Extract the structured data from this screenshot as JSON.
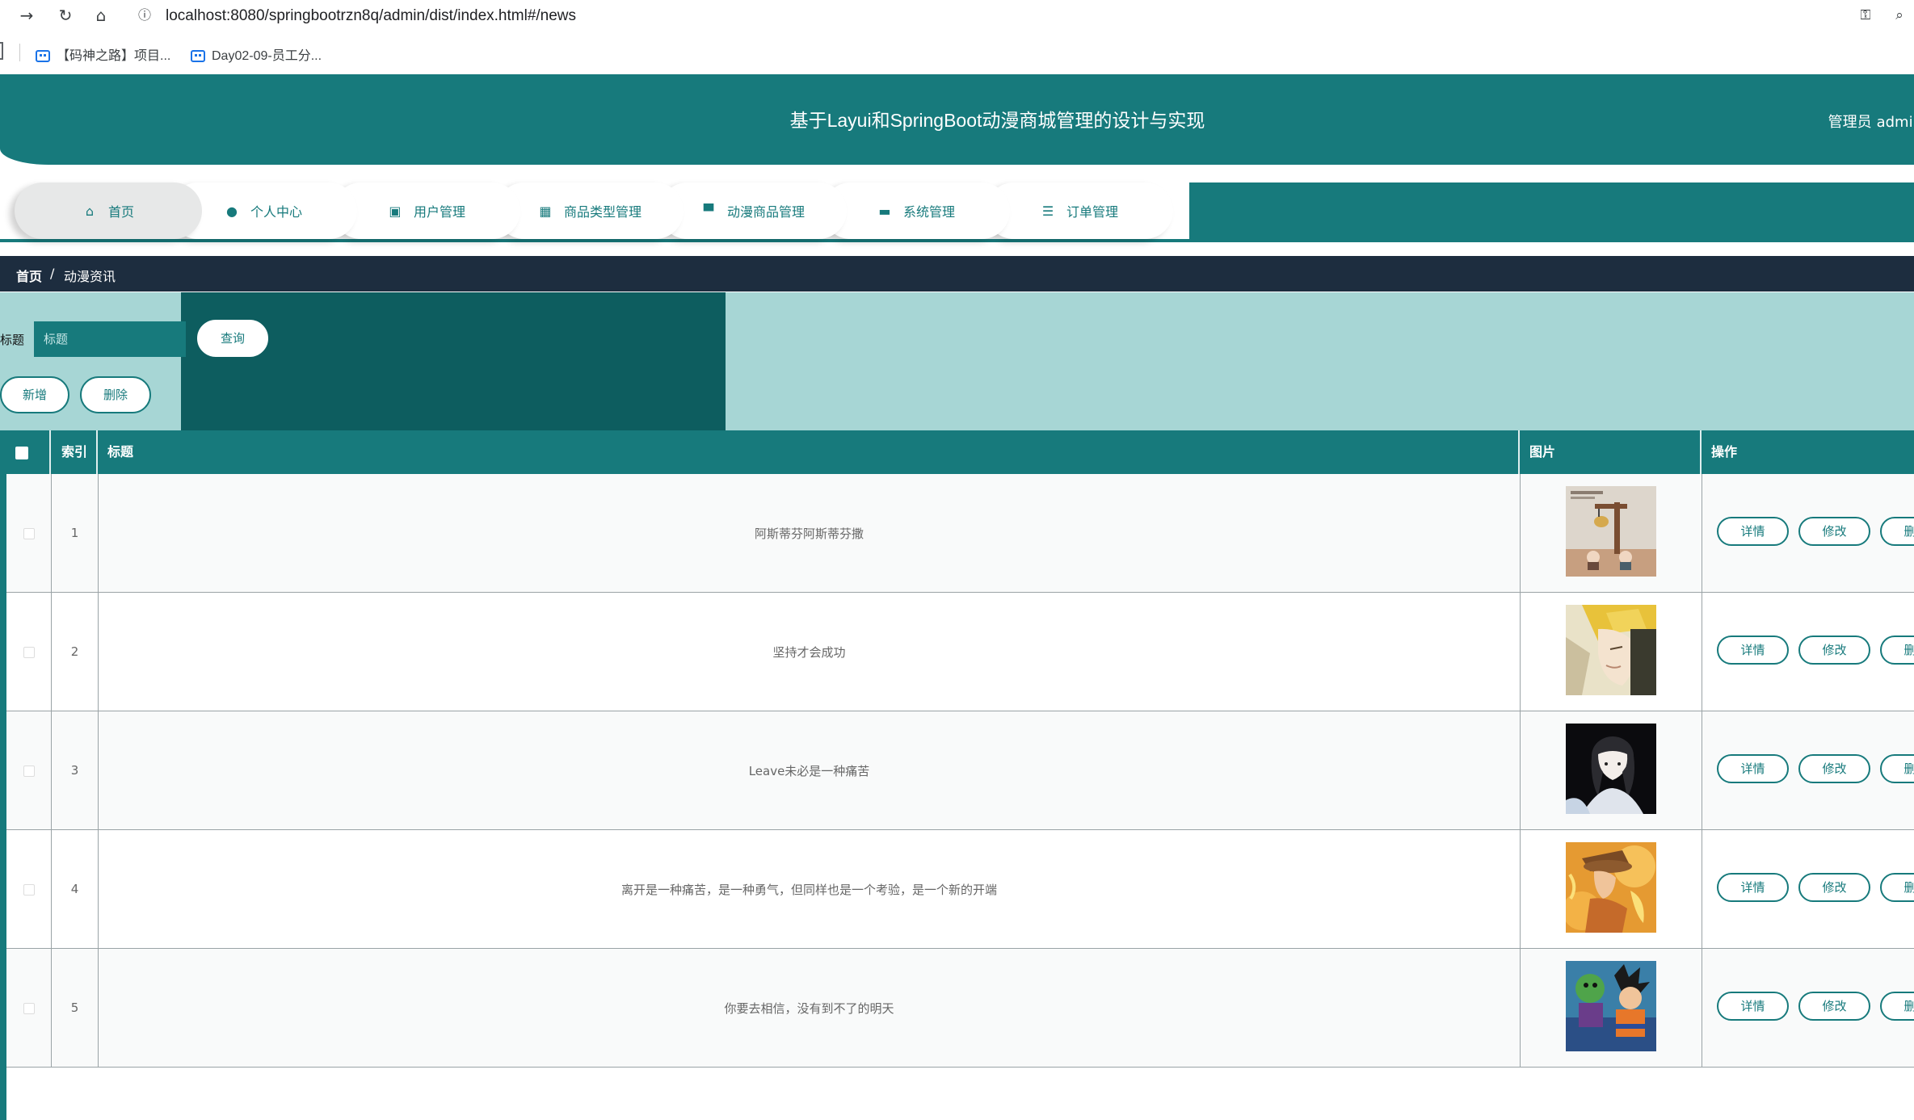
{
  "browser": {
    "url": "localhost:8080/springbootrzn8q/admin/dist/index.html#/news",
    "bookmarks": [
      "【码神之路】项目...",
      "Day02-09-员工分..."
    ]
  },
  "header": {
    "title": "基于Layui和SpringBoot动漫商城管理的设计与实现",
    "user_role": "管理员",
    "user_name": "admin"
  },
  "nav": [
    {
      "label": "首页",
      "icon": "home-icon"
    },
    {
      "label": "个人中心",
      "icon": "user-icon"
    },
    {
      "label": "用户管理",
      "icon": "clipboard-icon"
    },
    {
      "label": "商品类型管理",
      "icon": "grid-icon"
    },
    {
      "label": "动漫商品管理",
      "icon": "paint-roller-icon"
    },
    {
      "label": "系统管理",
      "icon": "briefcase-icon"
    },
    {
      "label": "订单管理",
      "icon": "sliders-icon"
    }
  ],
  "breadcrumb": {
    "home": "首页",
    "separator": "/",
    "current": "动漫资讯"
  },
  "search": {
    "label": "标题",
    "placeholder": "标题",
    "query_button": "查询",
    "add_button": "新增",
    "delete_button": "删除"
  },
  "table": {
    "headers": {
      "index": "索引",
      "title": "标题",
      "image": "图片",
      "action": "操作"
    },
    "actions": {
      "detail": "详情",
      "edit": "修改",
      "delete": "删除"
    },
    "rows": [
      {
        "index": "1",
        "title": "阿斯蒂芬阿斯蒂芬撒",
        "image": "figurine-scene"
      },
      {
        "index": "2",
        "title": "坚持才会成功",
        "image": "blonde-anime-character"
      },
      {
        "index": "3",
        "title": "Leave未必是一种痛苦",
        "image": "dark-haired-anime-girl"
      },
      {
        "index": "4",
        "title": "离开是一种痛苦，是一种勇气，但同样也是一个考验，是一个新的开端",
        "image": "fire-anime-character"
      },
      {
        "index": "5",
        "title": "你要去相信，没有到不了的明天",
        "image": "dragon-ball-characters"
      }
    ]
  },
  "colors": {
    "primary": "#177a7c",
    "panel_light": "#a7d6d5",
    "panel_dark": "#0d5d5f",
    "breadcrumb_bg": "#1d2d3f"
  }
}
